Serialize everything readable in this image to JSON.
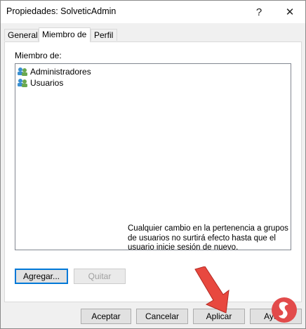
{
  "window": {
    "title": "Propiedades: SolveticAdmin",
    "help_glyph": "?",
    "close_glyph": "✕"
  },
  "tabs": [
    {
      "label": "General",
      "active": false
    },
    {
      "label": "Miembro de",
      "active": true
    },
    {
      "label": "Perfil",
      "active": false
    }
  ],
  "panel": {
    "list_label": "Miembro de:",
    "members": [
      {
        "name": "Administradores",
        "icon": "group-icon"
      },
      {
        "name": "Usuarios",
        "icon": "group-icon"
      }
    ],
    "add_button": "Agregar...",
    "remove_button": "Quitar",
    "note": "Cualquier cambio en la pertenencia a grupos de usuarios no surtirá efecto hasta que el usuario inicie sesión de nuevo."
  },
  "footer": {
    "ok": "Aceptar",
    "cancel": "Cancelar",
    "apply": "Aplicar",
    "help": "Ayuda"
  },
  "colors": {
    "accent_border": "#0078d7",
    "arrow_red": "#e8483f"
  }
}
